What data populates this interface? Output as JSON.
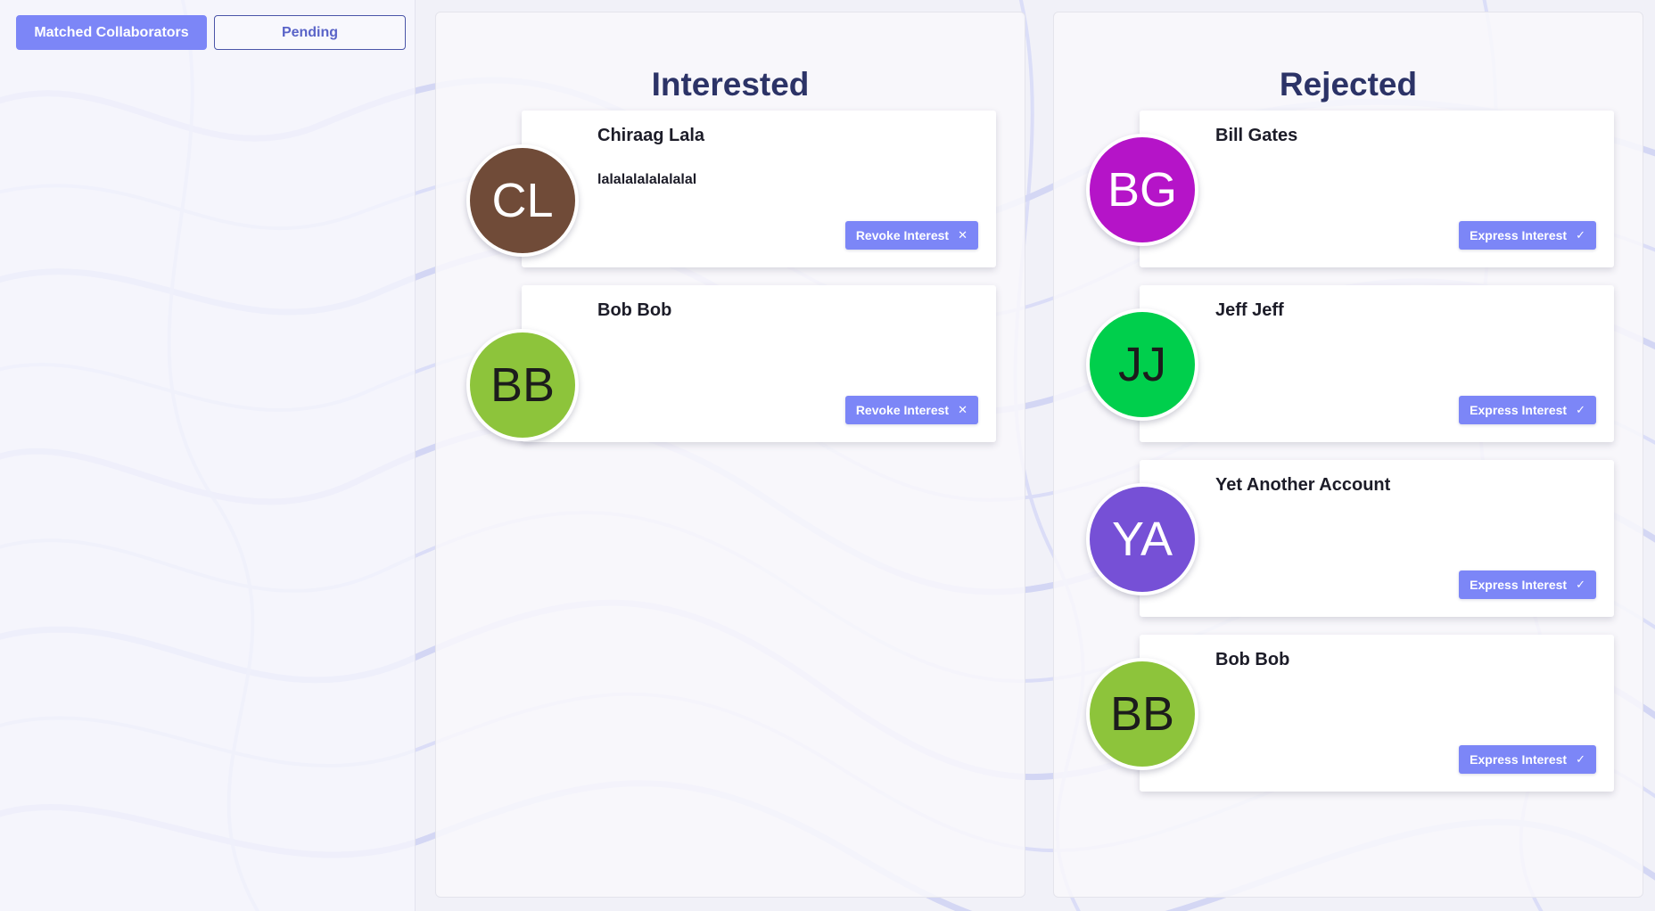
{
  "tabs": {
    "matched": "Matched Collaborators",
    "pending": "Pending"
  },
  "interested": {
    "title": "Interested",
    "cards": [
      {
        "initials": "CL",
        "name": "Chiraag Lala",
        "description": "lalalalalalalalal",
        "button": "Revoke Interest",
        "button_icon": "close-icon",
        "avatar_color": "#704b38",
        "text_color": "#ffffff"
      },
      {
        "initials": "BB",
        "name": "Bob Bob",
        "description": "",
        "button": "Revoke Interest",
        "button_icon": "close-icon",
        "avatar_color": "#8dc43b",
        "text_color": "#1c1c1c"
      }
    ]
  },
  "rejected": {
    "title": "Rejected",
    "cards": [
      {
        "initials": "BG",
        "name": "Bill Gates",
        "description": "",
        "button": "Express Interest",
        "button_icon": "check-icon",
        "avatar_color": "#b514c8",
        "text_color": "#ffffff"
      },
      {
        "initials": "JJ",
        "name": "Jeff Jeff",
        "description": "",
        "button": "Express Interest",
        "button_icon": "check-icon",
        "avatar_color": "#00cf4c",
        "text_color": "#1c1c1c"
      },
      {
        "initials": "YA",
        "name": "Yet Another Account",
        "description": "",
        "button": "Express Interest",
        "button_icon": "check-icon",
        "avatar_color": "#7650d6",
        "text_color": "#ffffff"
      },
      {
        "initials": "BB",
        "name": "Bob Bob",
        "description": "",
        "button": "Express Interest",
        "button_icon": "check-icon",
        "avatar_color": "#8dc43b",
        "text_color": "#1c1c1c"
      }
    ]
  },
  "colors": {
    "accent": "#7c86f7",
    "title": "#2c3367"
  }
}
